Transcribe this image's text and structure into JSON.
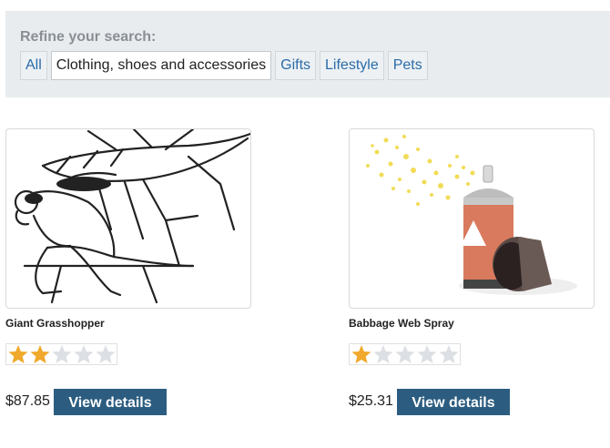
{
  "refine": {
    "title": "Refine your search:",
    "filters": [
      "All",
      "Clothing, shoes and accessories",
      "Gifts",
      "Lifestyle",
      "Pets"
    ],
    "selected": "Clothing, shoes and accessories"
  },
  "products": [
    {
      "name": "Giant Grasshopper",
      "rating": 2,
      "max_rating": 5,
      "price": "$87.85",
      "button": "View details"
    },
    {
      "name": "Babbage Web Spray",
      "rating": 1,
      "max_rating": 5,
      "price": "$25.31",
      "button": "View details"
    }
  ],
  "colors": {
    "star_filled": "#f0a92c",
    "star_empty": "#dcdfe3",
    "button_bg": "#2c5d80",
    "link": "#2a6ca8"
  }
}
